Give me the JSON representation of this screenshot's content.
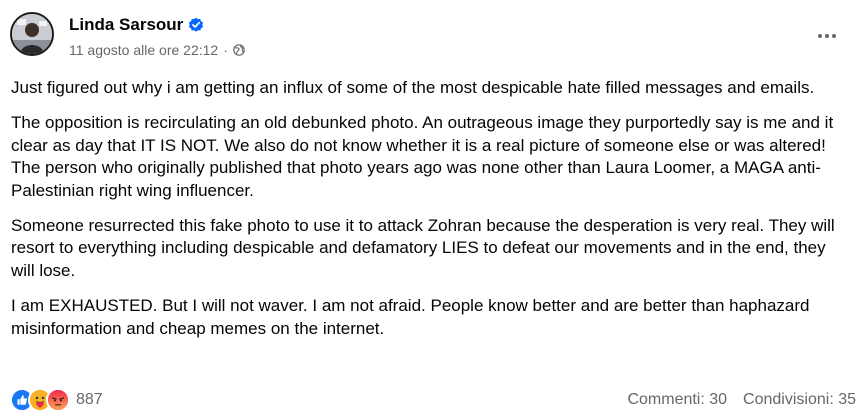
{
  "post": {
    "author": "Linda Sarsour",
    "timestamp": "11 agosto alle ore 22:12",
    "separator": "·",
    "paragraphs": [
      "Just figured out why i am getting an influx of some of the most despicable hate filled messages and emails.",
      "The opposition is recirculating an old debunked photo. An outrageous image they purportedly say is me and it clear as day that IT IS NOT. We also do not know whether it is a real picture of someone else or was altered! The person who originally published that photo years ago was none other than Laura Loomer, a MAGA anti-Palestinian right wing influencer.",
      "Someone resurrected this fake photo to use it to attack Zohran because the desperation is very real. They will resort to everything including despicable and defamatory LIES to defeat our movements and in the end, they will lose.",
      "I am EXHAUSTED. But I will not waver. I am not afraid. People know better and are better than haphazard misinformation and cheap memes on the internet."
    ]
  },
  "footer": {
    "reaction_count": "887",
    "comments": "Commenti: 30",
    "shares": "Condivisioni: 35",
    "reactions": [
      "like-icon",
      "care-icon",
      "angry-icon"
    ]
  },
  "colors": {
    "verified": "#0866ff",
    "like": "#1877f2",
    "care": "#f7b125",
    "angry": "#f0284a",
    "secondary_text": "#65676b"
  }
}
